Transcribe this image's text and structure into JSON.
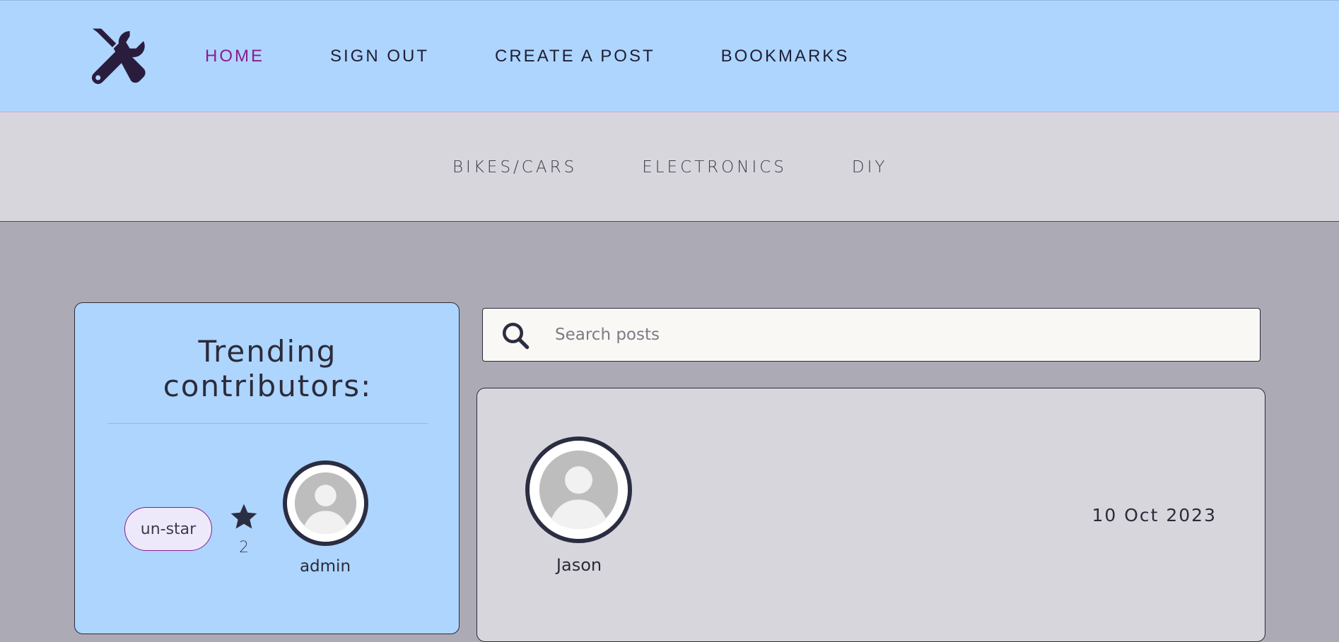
{
  "nav": {
    "logo": "tools-icon",
    "links": [
      {
        "label": "HOME",
        "active": true
      },
      {
        "label": "SIGN OUT"
      },
      {
        "label": "CREATE A POST"
      },
      {
        "label": "BOOKMARKS"
      }
    ]
  },
  "categories": [
    "BIKES/CARS",
    "ELECTRONICS",
    "DIY"
  ],
  "trending": {
    "title": "Trending contributors:",
    "contributors": [
      {
        "name": "admin",
        "button_label": "un-star",
        "stars": "2"
      }
    ]
  },
  "search": {
    "placeholder": "Search posts",
    "value": ""
  },
  "posts": [
    {
      "author": "Jason",
      "date": "10 Oct 2023"
    }
  ],
  "colors": {
    "navbar_bg": "#aed5fe",
    "category_bg": "#d8d6dd",
    "page_bg": "#acabb5",
    "active_link": "#8a1c8f",
    "dark": "#2b2b3a",
    "search_bg": "#faf8f4"
  }
}
